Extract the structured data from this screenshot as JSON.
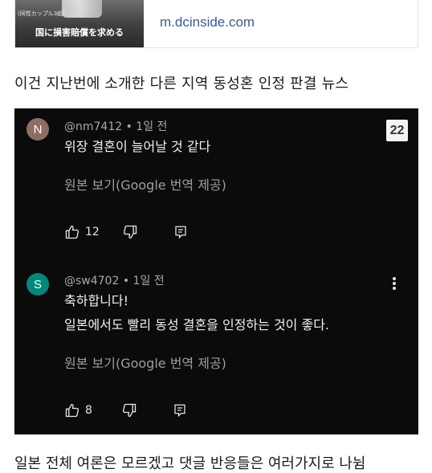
{
  "link_preview": {
    "thumb_small_text": "(同性カップル3組)",
    "thumb_caption": "国に損害賠償を求める",
    "domain": "m.dcinside.com"
  },
  "caption_top": "이건 지난번에 소개한 다른 지역 동성혼 인정 판결 뉴스",
  "caption_bottom": "일본 전체 여론은 모르겠고 댓글 반응들은 여러가지로 나뉨",
  "badge": "22",
  "comments": [
    {
      "avatar_letter": "N",
      "avatar_color": "#8d6e63",
      "handle": "@nm7412 • 1일 전",
      "lines": [
        "위장 결혼이 늘어날 것 같다"
      ],
      "translate": "원본 보기(Google 번역 제공)",
      "likes": "12"
    },
    {
      "avatar_letter": "S",
      "avatar_color": "#00897b",
      "handle": "@sw4702 • 1일 전",
      "lines": [
        "축하합니다!",
        "일본에서도 빨리 동성 결혼을 인정하는 것이 좋다."
      ],
      "translate": "원본 보기(Google 번역 제공)",
      "likes": "8"
    }
  ]
}
